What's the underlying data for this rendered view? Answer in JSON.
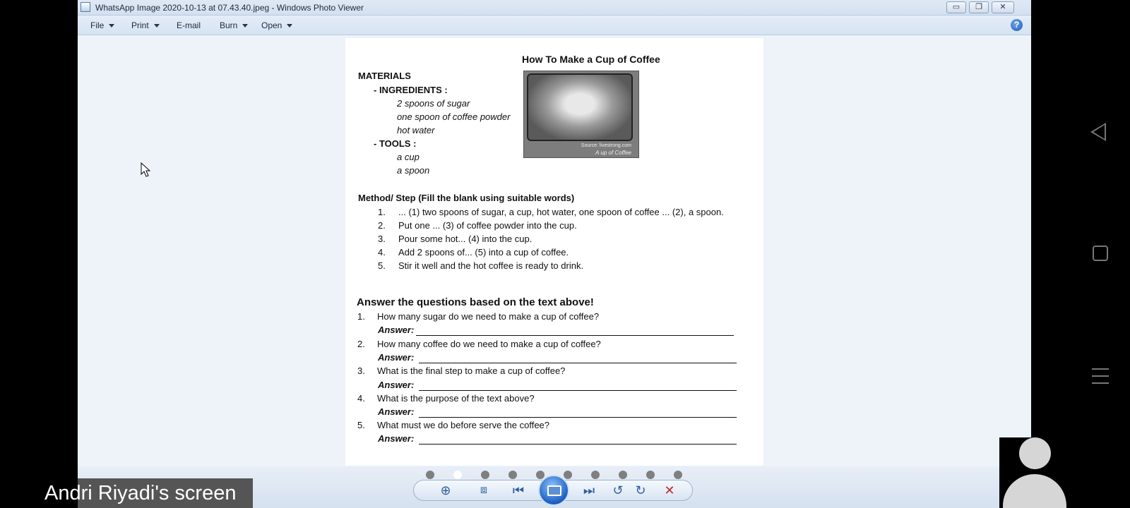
{
  "window": {
    "title": "WhatsApp Image 2020-10-13 at 07.43.40.jpeg - Windows Photo Viewer",
    "minimize": "▭",
    "maximize": "❐",
    "close": "✕"
  },
  "menu": {
    "file": "File",
    "print": "Print",
    "email": "E-mail",
    "burn": "Burn",
    "open": "Open",
    "help": "?"
  },
  "document": {
    "title": "How To Make a Cup of Coffee",
    "materials_heading": "MATERIALS",
    "ingredients_heading": "- INGREDIENTS :",
    "ingredients": [
      "2 spoons of sugar",
      "one spoon of coffee powder",
      "hot water"
    ],
    "tools_heading": "- TOOLS :",
    "tools": [
      "a cup",
      "a spoon"
    ],
    "photo_source": "Source: livestrong.com",
    "photo_caption": "A up of Coffee",
    "method_heading": "Method/ Step (Fill the blank using suitable words)",
    "steps": [
      {
        "num": "1.",
        "text": "... (1) two spoons of sugar, a cup, hot water, one spoon of coffee ... (2), a spoon."
      },
      {
        "num": "2.",
        "text": "Put one ... (3) of coffee powder into the cup."
      },
      {
        "num": "3.",
        "text": "Pour some hot... (4) into the cup."
      },
      {
        "num": "4.",
        "text": "Add 2 spoons of... (5) into a cup of coffee."
      },
      {
        "num": "5.",
        "text": "Stir it well and the hot coffee is ready to drink."
      }
    ],
    "questions_heading": "Answer the questions based on the text above!",
    "answer_label": "Answer:",
    "questions": [
      {
        "num": "1.",
        "text": "How many sugar do we need to make a cup of coffee?"
      },
      {
        "num": "2.",
        "text": "How many coffee do we need to make a cup of coffee?"
      },
      {
        "num": "3.",
        "text": "What is the final step to make a cup of coffee?"
      },
      {
        "num": "4.",
        "text": "What is the purpose of the text above?"
      },
      {
        "num": "5.",
        "text": "What must we do before serve the coffee?"
      }
    ]
  },
  "navbar": {
    "zoom_icon": "zoom-icon",
    "actual_size_icon": "fit-window-icon",
    "prev_icon": "previous-icon",
    "slideshow_icon": "slideshow-icon",
    "next_icon": "next-icon",
    "rotate_ccw_icon": "rotate-counterclockwise-icon",
    "rotate_cw_icon": "rotate-clockwise-icon",
    "delete_icon": "delete-icon",
    "zoom_glyph": "⊕",
    "fit_glyph": "⧈",
    "prev_glyph": "⏮",
    "next_glyph": "⏭",
    "rotate_ccw_glyph": "↺",
    "rotate_cw_glyph": "↻",
    "delete_glyph": "✕",
    "accent": "#1c5fc2",
    "delete_color": "#c0282d"
  },
  "overlay": {
    "screen_share_label": "Andri Riyadi's screen"
  }
}
